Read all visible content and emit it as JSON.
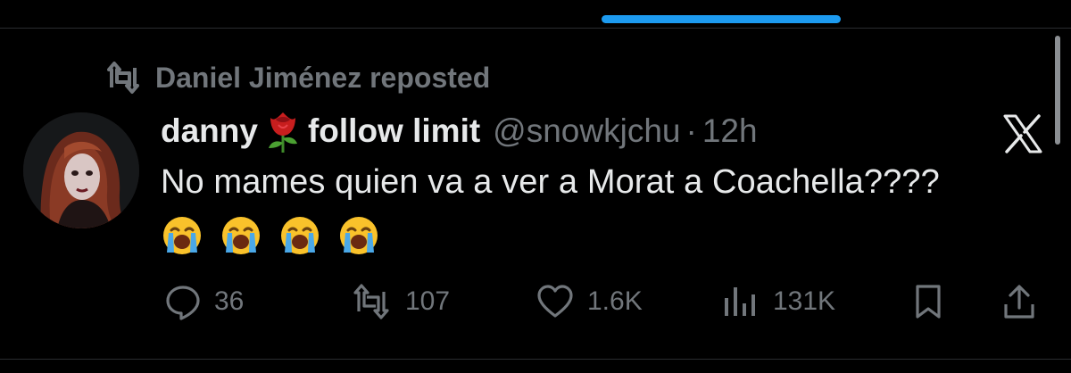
{
  "repost": {
    "text": "Daniel Jiménez reposted",
    "icon": "repost-icon"
  },
  "author": {
    "display_name_part1": "danny",
    "display_name_emoji": "rose-icon",
    "display_name_part2": "follow limit",
    "handle": "@snowkjchu",
    "separator": "·",
    "time": "12h"
  },
  "tweet": {
    "text": "No mames quien va a ver a Morat a Coachella????",
    "emojis": [
      "loudly-crying-face-icon",
      "loudly-crying-face-icon",
      "loudly-crying-face-icon",
      "loudly-crying-face-icon"
    ]
  },
  "actions": {
    "reply_count": "36",
    "repost_count": "107",
    "like_count": "1.6K",
    "view_count": "131K"
  },
  "colors": {
    "background": "#000000",
    "text_primary": "#e7e9ea",
    "text_secondary": "#71767b",
    "accent": "#1d9bf0"
  }
}
